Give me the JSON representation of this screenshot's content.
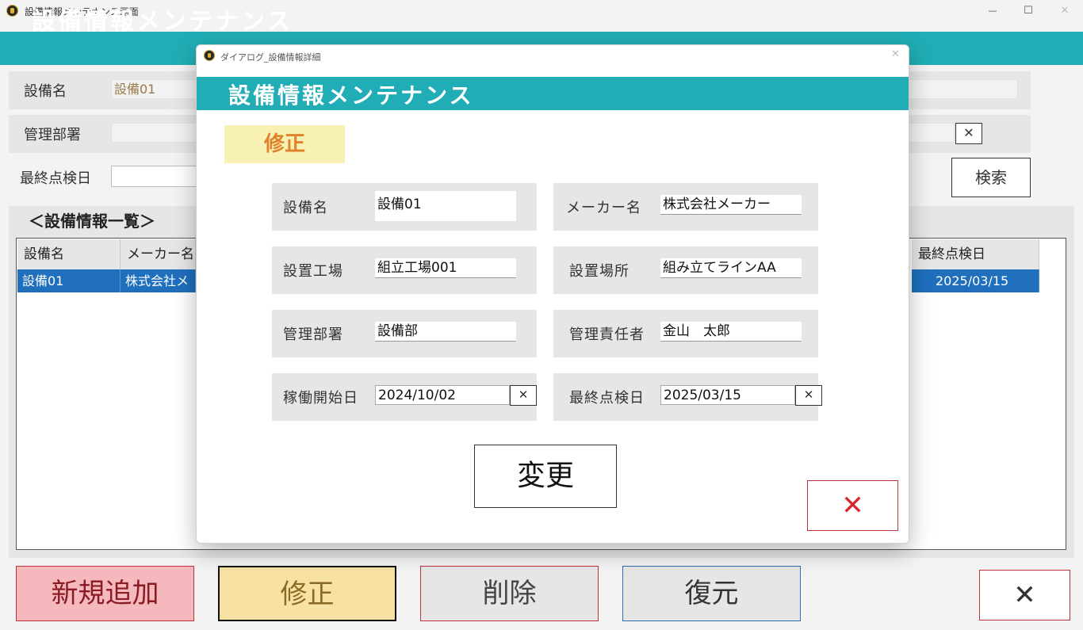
{
  "window": {
    "title": "設備情報メンテナンス画面",
    "controls": {
      "minimize": "—",
      "maximize": "☐",
      "close": "✕"
    }
  },
  "main": {
    "header_title": "設備情報メンテナンス",
    "search": {
      "equipment_name_label": "設備名",
      "equipment_name_value": "設備01",
      "department_label": "管理部署",
      "last_inspection_label": "最終点検日",
      "clear_label": "✕",
      "search_button": "検索"
    },
    "list": {
      "title": "＜設備情報一覧＞",
      "columns": [
        "設備名",
        "メーカー名",
        "最終点検日"
      ],
      "rows": [
        {
          "equipment": "設備01",
          "maker": "株式会社メ",
          "last_inspection": "2025/03/15"
        }
      ]
    },
    "buttons": {
      "add": "新規追加",
      "edit": "修正",
      "delete": "削除",
      "restore": "復元",
      "close": "✕"
    }
  },
  "dialog": {
    "title": "ダイアログ_設備情報詳細",
    "close_x": "✕",
    "header_title": "設備情報メンテナンス",
    "mode": "修正",
    "fields": {
      "equipment_name": {
        "label": "設備名",
        "value": "設備01"
      },
      "maker_name": {
        "label": "メーカー名",
        "value": "株式会社メーカー"
      },
      "factory": {
        "label": "設置工場",
        "value": "組立工場001"
      },
      "location": {
        "label": "設置場所",
        "value": "組み立てラインAA"
      },
      "department": {
        "label": "管理部署",
        "value": "設備部"
      },
      "manager": {
        "label": "管理責任者",
        "value": "金山　太郎"
      },
      "start_date": {
        "label": "稼働開始日",
        "value": "2024/10/02"
      },
      "last_inspection": {
        "label": "最終点検日",
        "value": "2025/03/15"
      }
    },
    "clear_label": "✕",
    "change_button": "変更",
    "close_button": "✕"
  },
  "colors": {
    "accent": "#21adb5",
    "selection": "#1f6fbd",
    "add": "#f5b9bd",
    "edit": "#f7e2a4",
    "danger": "#d9262e"
  }
}
